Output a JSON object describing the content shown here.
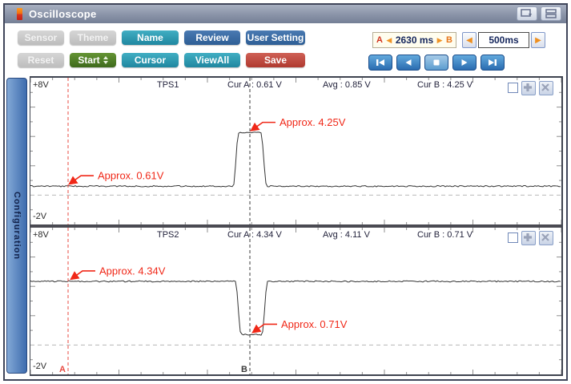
{
  "window": {
    "title": "Oscilloscope"
  },
  "titlebar_icons": [
    "app-icon",
    "panel-view-icon",
    "split-layout-icon"
  ],
  "toolbar": {
    "rows": [
      [
        {
          "label": "Sensor",
          "state": "disabled"
        },
        {
          "label": "Theme",
          "state": "disabled"
        },
        {
          "label": "Name",
          "state": "teal"
        },
        {
          "label": "Review",
          "state": "blue"
        },
        {
          "label": "User Setting",
          "state": "blue"
        }
      ],
      [
        {
          "label": "Reset",
          "state": "disabled"
        },
        {
          "label": "Start",
          "state": "green",
          "spinner": true
        },
        {
          "label": "Cursor",
          "state": "teal"
        },
        {
          "label": "ViewAll",
          "state": "teal"
        },
        {
          "label": "Save",
          "state": "red"
        }
      ]
    ]
  },
  "time_controls": {
    "a_label": "A",
    "b_label": "B",
    "left_arrow": "◀",
    "right_arrow": "▶",
    "ab_interval": "2630 ms",
    "timebase": "500ms"
  },
  "playback": {
    "buttons": [
      "skip-to-start",
      "step-back",
      "stop",
      "step-forward",
      "skip-to-end"
    ]
  },
  "sidebar": {
    "tab_label": "Configuration"
  },
  "cursors": [
    {
      "label": "A",
      "frac": 0.0709,
      "color": "#e84b42"
    },
    {
      "label": "B",
      "frac": 0.4133,
      "color": "#3a3a3a"
    }
  ],
  "colors": {
    "annotation": "#f02818",
    "waveform": "#353535",
    "tick": "#8f8f8f",
    "zero_line": "#b8b8b8",
    "teal_accent": "#2e9cb5",
    "blue_accent": "#3a6ea8",
    "green_accent": "#4e7d2a",
    "red_accent": "#c0493f"
  },
  "chart_data": [
    {
      "type": "line",
      "name": "TPS1",
      "header": {
        "v_top": "+8V",
        "v_bottom": "-2V",
        "cur_a_text": "Cur A : 0.61 V",
        "avg_text": "Avg : 0.85 V",
        "cur_b_text": "Cur B : 4.25 V"
      },
      "ylim": [
        -2,
        8
      ],
      "zero_line_v": 0,
      "waveform": {
        "shape": "pulse",
        "base_v": 0.61,
        "peak_v": 4.25,
        "edge1_frac": 0.382,
        "flat1_frac": 0.392,
        "flat2_frac": 0.434,
        "edge2_frac": 0.445
      },
      "annotations": [
        {
          "text": "Approx. 0.61V",
          "tip_frac": 0.0739,
          "tip_v": 0.61
        },
        {
          "text": "Approx. 4.25V",
          "tip_frac": 0.4163,
          "tip_v": 4.25
        }
      ]
    },
    {
      "type": "line",
      "name": "TPS2",
      "header": {
        "v_top": "+8V",
        "v_bottom": "-2V",
        "cur_a_text": "Cur A : 4.34 V",
        "avg_text": "Avg : 4.11 V",
        "cur_b_text": "Cur B : 0.71 V"
      },
      "ylim": [
        -2,
        8
      ],
      "zero_line_v": 0,
      "waveform": {
        "shape": "pulse",
        "base_v": 4.34,
        "peak_v": 0.71,
        "edge1_frac": 0.3861,
        "flat1_frac": 0.3967,
        "flat2_frac": 0.4359,
        "edge2_frac": 0.4465
      },
      "annotations": [
        {
          "text": "Approx. 4.34V",
          "tip_frac": 0.0769,
          "tip_v": 4.34
        },
        {
          "text": "Approx. 0.71V",
          "tip_frac": 0.4193,
          "tip_v": 0.71
        }
      ]
    }
  ]
}
